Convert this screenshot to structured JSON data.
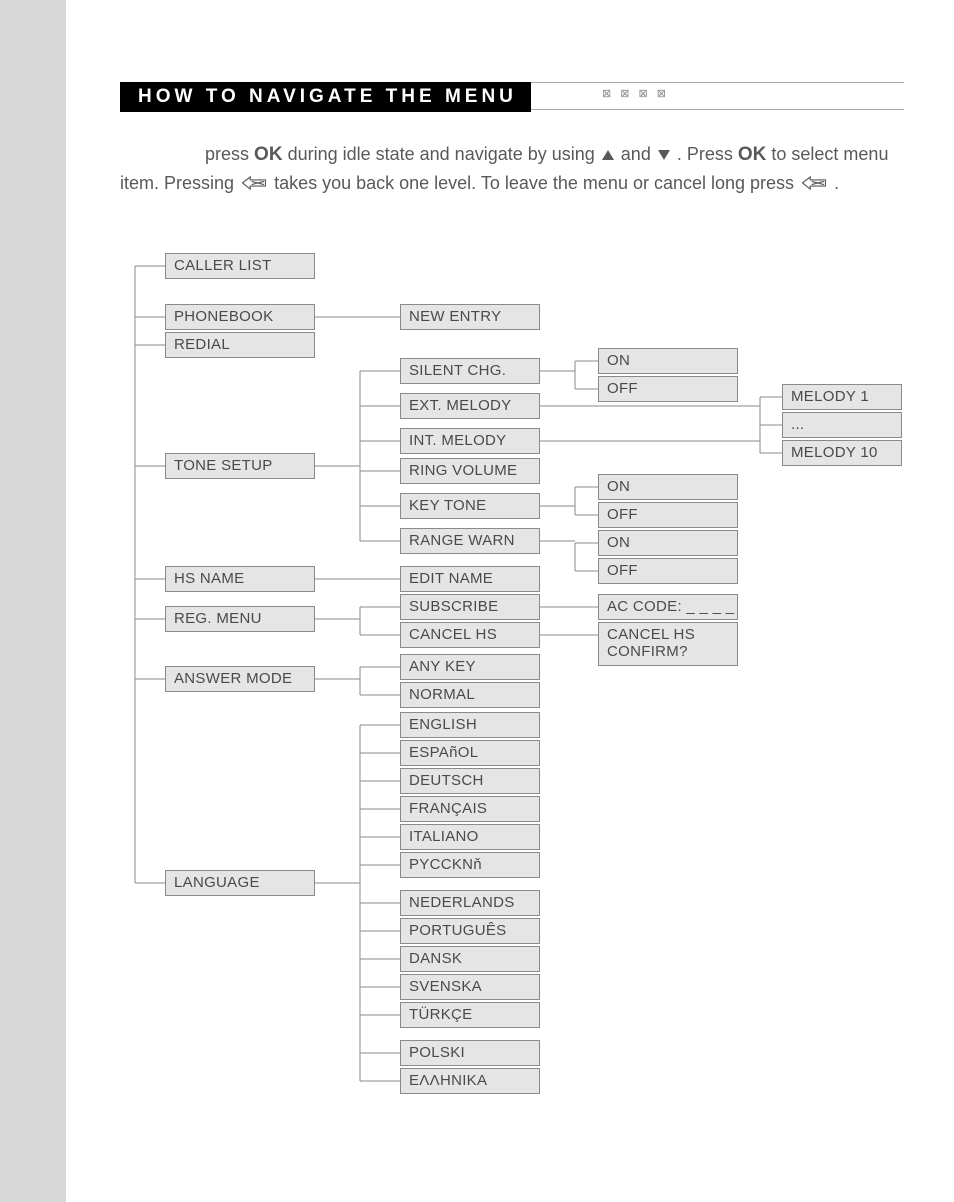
{
  "header": {
    "title": "HOW TO NAVIGATE THE MENU",
    "page_mark": "⊠ ⊠ ⊠  ⊠"
  },
  "intro": {
    "pre": "press ",
    "ok1": "OK",
    "mid1": " during idle state and navigate by using ",
    "and": " and ",
    "mid2": ". Press ",
    "ok2": "OK",
    "mid3": " to select menu item. Pressing ",
    "mid4": " takes you back one level. To leave the menu or cancel long press ",
    "end": "."
  },
  "menu": {
    "col1": [
      "CALLER LIST",
      "PHONEBOOK",
      "REDIAL",
      "TONE SETUP",
      "HS NAME",
      "REG. MENU",
      "ANSWER MODE",
      "LANGUAGE"
    ],
    "phonebook_sub": [
      "NEW ENTRY"
    ],
    "tone_sub": [
      "SILENT CHG.",
      "EXT. MELODY",
      "INT. MELODY",
      "RING VOLUME",
      "KEY TONE",
      "RANGE WARN"
    ],
    "silent_sub": [
      "ON",
      "OFF"
    ],
    "keytone_sub": [
      "ON",
      "OFF"
    ],
    "rangewarn_sub": [
      "ON",
      "OFF"
    ],
    "melody_sub": [
      "MELODY 1",
      "...",
      "MELODY 10"
    ],
    "hsname_sub": [
      "EDIT NAME"
    ],
    "reg_sub": [
      "SUBSCRIBE",
      "CANCEL HS"
    ],
    "subscribe_sub": [
      "AC CODE: _ _ _ _"
    ],
    "cancelhs_sub": [
      "CANCEL HS\nCONFIRM?"
    ],
    "answer_sub": [
      "ANY KEY",
      "NORMAL"
    ],
    "language_sub": [
      "ENGLISH",
      "ESPAñOL",
      "DEUTSCH",
      "FRANÇAIS",
      "ITALIANO",
      "PYCCKNň",
      "NEDERLANDS",
      "PORTUGUÊS",
      "DANSK",
      "SVENSKA",
      "TÜRKÇE",
      "POLSKI",
      "EΛΛHNIKA"
    ]
  }
}
